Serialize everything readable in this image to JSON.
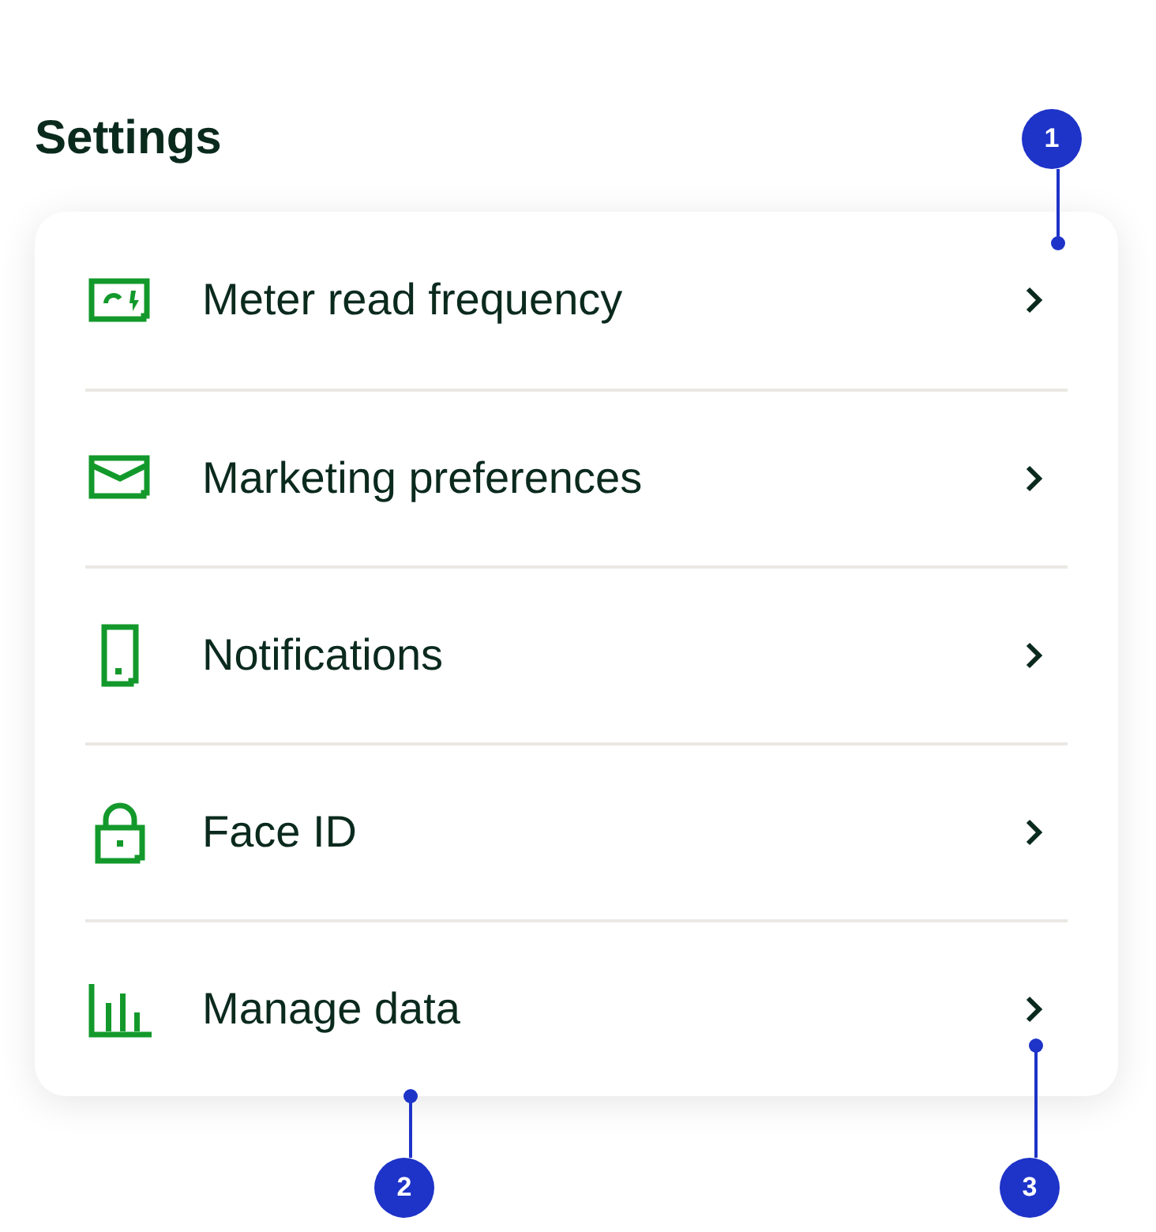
{
  "title": "Settings",
  "items": [
    {
      "label": "Meter read frequency",
      "kind": "meter"
    },
    {
      "label": "Marketing preferences",
      "kind": "mail"
    },
    {
      "label": "Notifications",
      "kind": "phone"
    },
    {
      "label": "Face ID",
      "kind": "lock"
    },
    {
      "label": "Manage data",
      "kind": "chart"
    }
  ],
  "markers": [
    {
      "label": "1",
      "kind": "top-right"
    },
    {
      "label": "2",
      "kind": "bottom"
    },
    {
      "label": "3",
      "kind": "bottom-right"
    }
  ]
}
